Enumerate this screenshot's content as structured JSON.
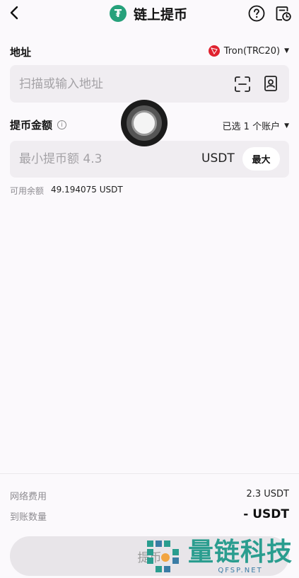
{
  "header": {
    "title": "链上提币",
    "coin_symbol": "₮",
    "coin_color": "#26a17b"
  },
  "address": {
    "label": "地址",
    "network": "Tron(TRC20)",
    "network_color": "#e0222f",
    "placeholder": "扫描或输入地址",
    "value": ""
  },
  "amount": {
    "label": "提币金额",
    "info_symbol": "i",
    "account_selector": "已选 1 个账户",
    "placeholder": "最小提币额 4.3",
    "value": "",
    "unit": "USDT",
    "max_label": "最大",
    "available_label": "可用余额",
    "available_value": "49.194075 USDT"
  },
  "summary": {
    "fee_label": "网络费用",
    "fee_value": "2.3 USDT",
    "receive_label": "到账数量",
    "receive_value": "- USDT"
  },
  "submit": {
    "label": "提币"
  },
  "watermark": {
    "name": "量链科技",
    "site": "QFSP.NET"
  }
}
